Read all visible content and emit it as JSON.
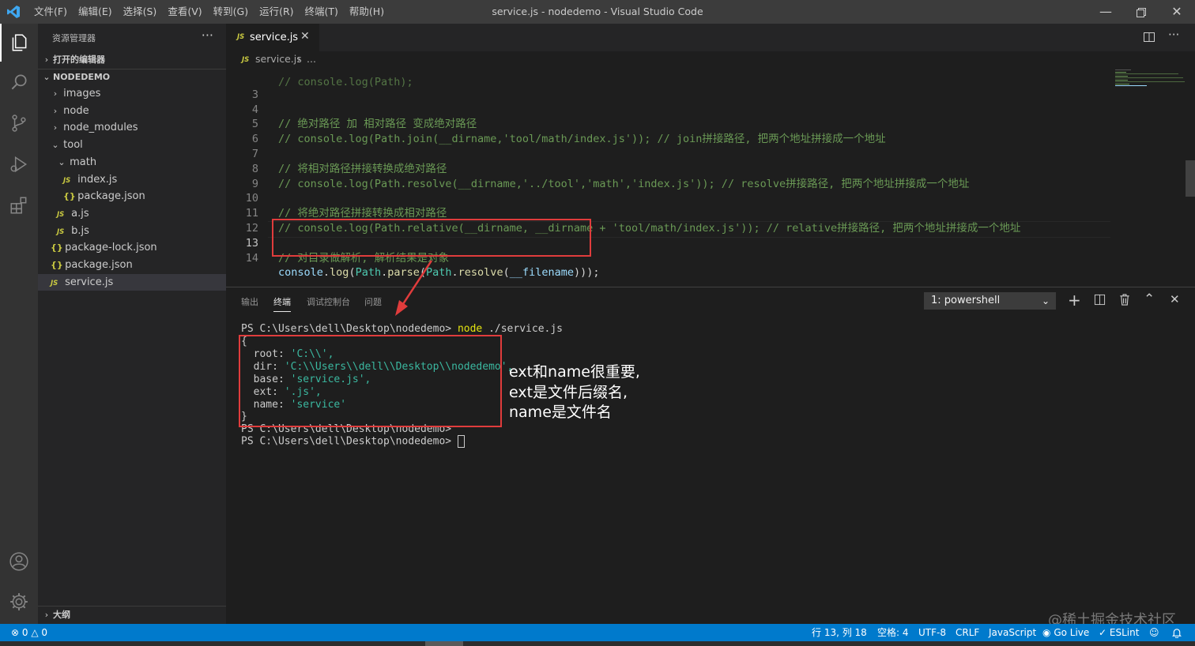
{
  "app": {
    "title": "service.js - nodedemo - Visual Studio Code",
    "menu": [
      "文件(F)",
      "编辑(E)",
      "选择(S)",
      "查看(V)",
      "转到(G)",
      "运行(R)",
      "终端(T)",
      "帮助(H)"
    ]
  },
  "colors": {
    "accent": "#007acc",
    "highlight_box": "#e03c3c",
    "comment": "#6a9955",
    "function": "#dcdcaa"
  },
  "activity_bar": {
    "icons": [
      "explorer-icon",
      "search-icon",
      "source-control-icon",
      "run-debug-icon",
      "extensions-icon",
      "account-icon",
      "manage-gear-icon"
    ]
  },
  "sidebar": {
    "title": "资源管理器",
    "more": "···",
    "open_editors": "打开的编辑器",
    "project": "NODEDEMO",
    "tree": [
      {
        "label": "images",
        "kind": "folder",
        "expanded": false
      },
      {
        "label": "node",
        "kind": "folder",
        "expanded": false
      },
      {
        "label": "node_modules",
        "kind": "folder",
        "expanded": false
      },
      {
        "label": "tool",
        "kind": "folder",
        "expanded": true
      },
      {
        "label": "math",
        "kind": "folder",
        "expanded": true
      },
      {
        "label": "index.js",
        "kind": "js"
      },
      {
        "label": "package.json",
        "kind": "json"
      },
      {
        "label": "a.js",
        "kind": "js"
      },
      {
        "label": "b.js",
        "kind": "js"
      },
      {
        "label": "package-lock.json",
        "kind": "json"
      },
      {
        "label": "package.json",
        "kind": "json"
      },
      {
        "label": "service.js",
        "kind": "js",
        "selected": true
      }
    ],
    "outline": "大纲"
  },
  "editor": {
    "tab_label": "service.js",
    "tab_icon_text": "JS",
    "breadcrumb": {
      "file": "service.js",
      "sep": "›",
      "rest": "..."
    },
    "partial_line": "// console.log(Path);",
    "lines": [
      {
        "n": "3",
        "text": ""
      },
      {
        "n": "4",
        "text": "// 绝对路径 加 相对路径 变成绝对路径"
      },
      {
        "n": "5",
        "text": "// console.log(Path.join(__dirname,'tool/math/index.js')); // join拼接路径, 把两个地址拼接成一个地址"
      },
      {
        "n": "6",
        "text": ""
      },
      {
        "n": "7",
        "text": "// 将相对路径拼接转换成绝对路径"
      },
      {
        "n": "8",
        "text": "// console.log(Path.resolve(__dirname,'../tool','math','index.js')); // resolve拼接路径, 把两个地址拼接成一个地址"
      },
      {
        "n": "9",
        "text": ""
      },
      {
        "n": "10",
        "text": "// 将绝对路径拼接转换成相对路径"
      },
      {
        "n": "11",
        "text": "// console.log(Path.relative(__dirname, __dirname + 'tool/math/index.js')); // relative拼接路径, 把两个地址拼接成一个地址"
      },
      {
        "n": "12",
        "text": ""
      },
      {
        "n": "13",
        "text": "// 对目录做解析, 解析结果是对象"
      },
      {
        "n": "14",
        "text": "console.log(Path.parse(Path.resolve(__filename)));"
      }
    ],
    "code14": {
      "t1": "console",
      "t2": ".",
      "t3": "log",
      "t4": "(",
      "t5": "Path",
      "t6": ".",
      "t7": "parse",
      "t8": "(",
      "t9": "Path",
      "t10": ".",
      "t11": "resolve",
      "t12": "(",
      "t13": "__filename",
      "t14": ")));"
    }
  },
  "panel": {
    "tabs": [
      "输出",
      "终端",
      "调试控制台",
      "问题"
    ],
    "active_tab": "终端",
    "terminal_select": "1: powershell",
    "terminal": {
      "prompt": "PS C:\\Users\\dell\\Desktop\\nodedemo> ",
      "cmd_node": "node",
      "cmd_args": " ./service.js",
      "open_brace": "{",
      "root_key": "  root: ",
      "root_val": "'C:\\\\',",
      "dir_key": "  dir: ",
      "dir_val": "'C:\\\\Users\\\\dell\\\\Desktop\\\\nodedemo',",
      "base_key": "  base: ",
      "base_val": "'service.js',",
      "ext_key": "  ext: ",
      "ext_val": "'.js',",
      "name_key": "  name: ",
      "name_val": "'service'",
      "close_brace": "}",
      "prompt2": "PS C:\\Users\\dell\\Desktop\\nodedemo>",
      "prompt3": "PS C:\\Users\\dell\\Desktop\\nodedemo> "
    }
  },
  "annotation": {
    "line1": "ext和name很重要,",
    "line2": "ext是文件后缀名,",
    "line3": "name是文件名"
  },
  "statusbar": {
    "errors": "0",
    "warnings": "0",
    "position": "行 13, 列 18",
    "indent": "空格: 4",
    "encoding": "UTF-8",
    "eol": "CRLF",
    "language": "JavaScript",
    "golive": "Go Live",
    "eslint": "ESLint"
  },
  "watermark": "@稀土掘金技术社区"
}
